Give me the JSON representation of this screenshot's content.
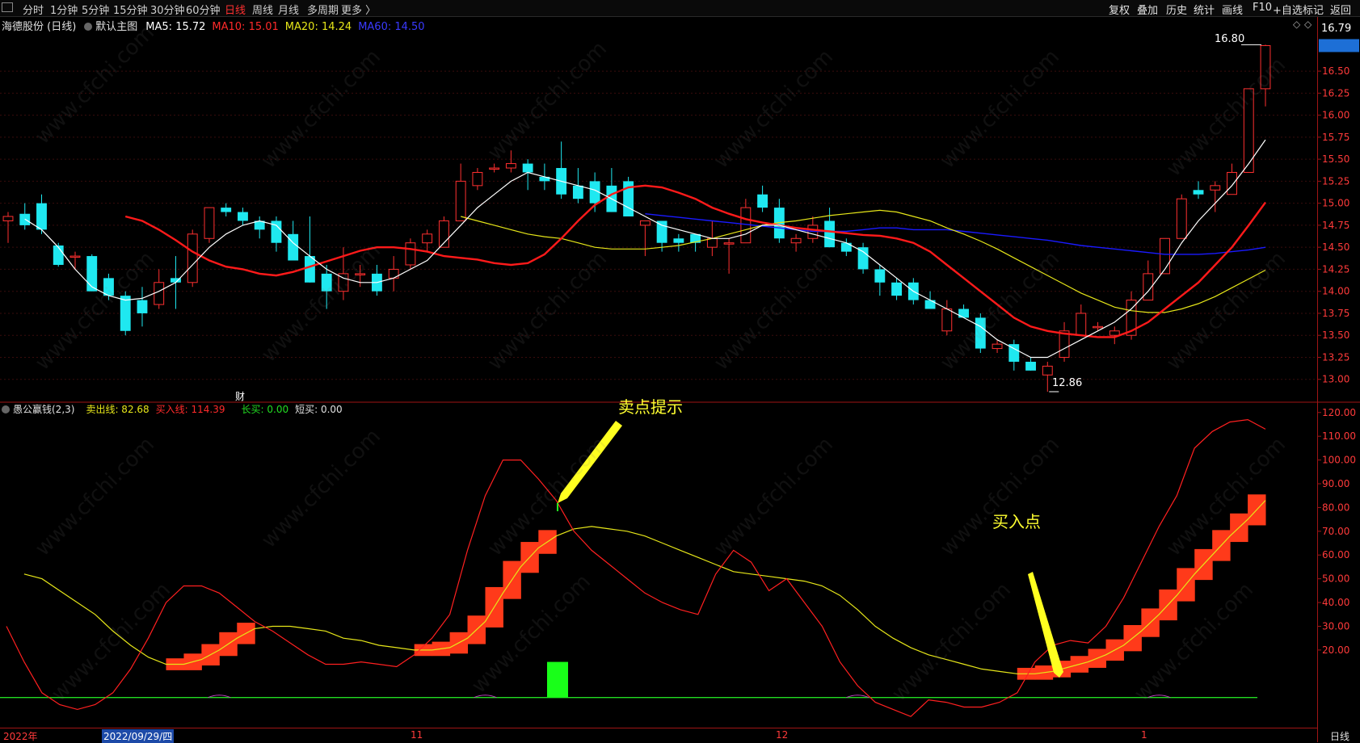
{
  "toolbar": {
    "left": [
      "分时",
      "1分钟",
      "5分钟",
      "15分钟",
      "30分钟",
      "60分钟",
      "日线",
      "周线",
      "月线",
      "多周期",
      "更多 〉"
    ],
    "active": "日线",
    "right": [
      "复权",
      "叠加",
      "历史",
      "统计",
      "画线",
      "F10",
      "+自选",
      "标记",
      "返回"
    ]
  },
  "main_header": {
    "stock": "海德股份 (日线)",
    "chart_name": "默认主图",
    "ma5": "MA5: 15.72",
    "ma10": "MA10: 15.01",
    "ma20": "MA20: 14.24",
    "ma60": "MA60: 14.50"
  },
  "sub_header": {
    "indicator": "愚公赢钱(2,3)",
    "sell": "卖出线: 82.68",
    "buy": "买入线: 114.39",
    "long": "长买: 0.00",
    "short": "短买: 0.00"
  },
  "annotations": {
    "sell_tip": "卖点提示",
    "buy_point": "买入点",
    "high": "16.80",
    "low": "12.86",
    "current": "16.79",
    "fin": "财"
  },
  "xaxis": {
    "year": "2022年",
    "date": "2022/09/29/四",
    "nov": "11",
    "dec": "12",
    "jan": "1",
    "period": "日线"
  },
  "watermark": "www.cfchi.com",
  "colors": {
    "up": "#ff3030",
    "down": "#1fe8f0",
    "ma5": "#ffffff",
    "ma10": "#ff1a1a",
    "ma20": "#e6e619",
    "ma60": "#1a1aff"
  },
  "chart_data": [
    {
      "type": "candlestick",
      "title": "海德股份 (日线)",
      "yticks": [
        13.0,
        13.25,
        13.5,
        13.75,
        14.0,
        14.25,
        14.5,
        14.75,
        15.0,
        15.25,
        15.5,
        15.75,
        16.0,
        16.25,
        16.5
      ],
      "ylim": [
        12.75,
        16.95
      ],
      "ohlc": [
        [
          14.8,
          14.9,
          14.55,
          14.85
        ],
        [
          14.88,
          15.0,
          14.7,
          14.75
        ],
        [
          15.0,
          15.1,
          14.65,
          14.7
        ],
        [
          14.52,
          14.55,
          14.28,
          14.3
        ],
        [
          14.4,
          14.45,
          14.25,
          14.4
        ],
        [
          14.4,
          14.42,
          14.0,
          14.0
        ],
        [
          14.15,
          14.2,
          13.9,
          13.95
        ],
        [
          13.95,
          14.0,
          13.5,
          13.55
        ],
        [
          13.9,
          14.05,
          13.6,
          13.75
        ],
        [
          13.85,
          14.25,
          13.8,
          14.1
        ],
        [
          14.15,
          14.4,
          13.8,
          14.1
        ],
        [
          14.1,
          14.7,
          14.05,
          14.65
        ],
        [
          14.6,
          14.95,
          14.55,
          14.95
        ],
        [
          14.95,
          15.0,
          14.85,
          14.9
        ],
        [
          14.9,
          14.95,
          14.75,
          14.8
        ],
        [
          14.8,
          14.85,
          14.6,
          14.7
        ],
        [
          14.8,
          14.85,
          14.45,
          14.55
        ],
        [
          14.65,
          14.8,
          14.45,
          14.35
        ],
        [
          14.4,
          14.85,
          14.1,
          14.1
        ],
        [
          14.2,
          14.3,
          13.8,
          14.0
        ],
        [
          14.0,
          14.5,
          13.9,
          14.2
        ],
        [
          14.2,
          14.3,
          14.05,
          14.2
        ],
        [
          14.2,
          14.3,
          13.95,
          14.0
        ],
        [
          14.15,
          14.4,
          14.0,
          14.25
        ],
        [
          14.3,
          14.6,
          14.25,
          14.55
        ],
        [
          14.55,
          14.7,
          14.45,
          14.65
        ],
        [
          14.5,
          14.85,
          14.5,
          14.8
        ],
        [
          14.8,
          15.45,
          14.8,
          15.25
        ],
        [
          15.2,
          15.4,
          15.15,
          15.35
        ],
        [
          15.4,
          15.45,
          15.35,
          15.4
        ],
        [
          15.4,
          15.6,
          15.35,
          15.45
        ],
        [
          15.45,
          15.5,
          15.15,
          15.35
        ],
        [
          15.3,
          15.45,
          15.15,
          15.25
        ],
        [
          15.4,
          15.7,
          15.05,
          15.1
        ],
        [
          15.2,
          15.4,
          15.0,
          15.05
        ],
        [
          15.25,
          15.35,
          14.9,
          15.0
        ],
        [
          15.2,
          15.4,
          14.9,
          14.9
        ],
        [
          15.25,
          15.3,
          14.85,
          14.85
        ],
        [
          14.75,
          14.8,
          14.4,
          14.8
        ],
        [
          14.8,
          14.8,
          14.45,
          14.55
        ],
        [
          14.6,
          14.65,
          14.45,
          14.55
        ],
        [
          14.65,
          14.65,
          14.45,
          14.55
        ],
        [
          14.5,
          14.8,
          14.4,
          14.6
        ],
        [
          14.55,
          14.6,
          14.2,
          14.55
        ],
        [
          14.55,
          15.05,
          14.55,
          14.95
        ],
        [
          15.1,
          15.2,
          14.9,
          14.95
        ],
        [
          14.95,
          15.05,
          14.55,
          14.6
        ],
        [
          14.55,
          14.65,
          14.45,
          14.6
        ],
        [
          14.6,
          14.85,
          14.55,
          14.75
        ],
        [
          14.8,
          14.95,
          14.5,
          14.5
        ],
        [
          14.55,
          14.6,
          14.4,
          14.45
        ],
        [
          14.5,
          14.55,
          14.2,
          14.25
        ],
        [
          14.25,
          14.3,
          13.95,
          14.1
        ],
        [
          14.1,
          14.15,
          13.9,
          13.95
        ],
        [
          14.1,
          14.15,
          13.85,
          13.9
        ],
        [
          13.9,
          14.0,
          13.8,
          13.8
        ],
        [
          13.55,
          13.9,
          13.5,
          13.8
        ],
        [
          13.8,
          13.85,
          13.7,
          13.7
        ],
        [
          13.7,
          13.75,
          13.3,
          13.35
        ],
        [
          13.35,
          13.45,
          13.3,
          13.4
        ],
        [
          13.4,
          13.45,
          13.1,
          13.2
        ],
        [
          13.2,
          13.25,
          13.1,
          13.1
        ],
        [
          13.05,
          13.2,
          12.86,
          13.15
        ],
        [
          13.25,
          13.65,
          13.2,
          13.55
        ],
        [
          13.5,
          13.85,
          13.5,
          13.75
        ],
        [
          13.6,
          13.65,
          13.55,
          13.6
        ],
        [
          13.5,
          13.6,
          13.4,
          13.55
        ],
        [
          13.5,
          14.0,
          13.45,
          13.9
        ],
        [
          13.9,
          14.35,
          13.9,
          14.2
        ],
        [
          14.2,
          14.6,
          14.2,
          14.6
        ],
        [
          14.6,
          15.1,
          14.6,
          15.05
        ],
        [
          15.15,
          15.25,
          15.05,
          15.1
        ],
        [
          15.15,
          15.25,
          14.9,
          15.2
        ],
        [
          15.1,
          15.45,
          15.1,
          15.35
        ],
        [
          15.35,
          16.3,
          15.35,
          16.3
        ],
        [
          16.3,
          16.8,
          16.1,
          16.79
        ]
      ],
      "ma5": [
        14.82,
        14.7,
        14.5,
        14.25,
        14.05,
        13.95,
        13.9,
        13.92,
        14.0,
        14.1,
        14.3,
        14.5,
        14.65,
        14.75,
        14.8,
        14.75,
        14.55,
        14.4,
        14.25,
        14.15,
        14.1,
        14.1,
        14.15,
        14.25,
        14.35,
        14.55,
        14.75,
        14.95,
        15.1,
        15.25,
        15.35,
        15.3,
        15.25,
        15.2,
        15.15,
        15.05,
        14.95,
        14.85,
        14.75,
        14.7,
        14.65,
        14.6,
        14.6,
        14.65,
        14.75,
        14.75,
        14.7,
        14.65,
        14.6,
        14.55,
        14.45,
        14.3,
        14.15,
        14.0,
        13.9,
        13.8,
        13.7,
        13.6,
        13.45,
        13.35,
        13.25,
        13.25,
        13.35,
        13.45,
        13.55,
        13.65,
        13.8,
        14.0,
        14.25,
        14.55,
        14.8,
        15.0,
        15.2,
        15.45,
        15.72
      ],
      "ma10": [
        14.85,
        14.8,
        14.7,
        14.58,
        14.45,
        14.35,
        14.28,
        14.25,
        14.2,
        14.18,
        14.22,
        14.28,
        14.34,
        14.4,
        14.46,
        14.5,
        14.5,
        14.48,
        14.45,
        14.4,
        14.38,
        14.36,
        14.32,
        14.3,
        14.32,
        14.42,
        14.6,
        14.8,
        14.98,
        15.1,
        15.18,
        15.2,
        15.18,
        15.12,
        15.05,
        14.95,
        14.88,
        14.82,
        14.78,
        14.75,
        14.72,
        14.7,
        14.68,
        14.66,
        14.64,
        14.63,
        14.6,
        14.55,
        14.45,
        14.3,
        14.15,
        14.0,
        13.85,
        13.7,
        13.6,
        13.55,
        13.52,
        13.5,
        13.48,
        13.48,
        13.55,
        13.65,
        13.8,
        13.95,
        14.1,
        14.3,
        14.5,
        14.75,
        15.01
      ],
      "ma20": [
        14.85,
        14.8,
        14.75,
        14.7,
        14.65,
        14.62,
        14.6,
        14.55,
        14.5,
        14.48,
        14.48,
        14.48,
        14.5,
        14.52,
        14.56,
        14.6,
        14.65,
        14.7,
        14.75,
        14.78,
        14.8,
        14.83,
        14.86,
        14.88,
        14.9,
        14.92,
        14.9,
        14.85,
        14.8,
        14.72,
        14.65,
        14.57,
        14.48,
        14.38,
        14.28,
        14.18,
        14.08,
        13.98,
        13.9,
        13.82,
        13.78,
        13.76,
        13.76,
        13.8,
        13.86,
        13.94,
        14.04,
        14.14,
        14.24
      ],
      "ma60": [
        14.88,
        14.86,
        14.84,
        14.82,
        14.8,
        14.78,
        14.76,
        14.74,
        14.72,
        14.7,
        14.68,
        14.68,
        14.68,
        14.7,
        14.72,
        14.72,
        14.7,
        14.7,
        14.7,
        14.68,
        14.66,
        14.64,
        14.62,
        14.6,
        14.58,
        14.55,
        14.52,
        14.5,
        14.48,
        14.46,
        14.44,
        14.42,
        14.42,
        14.42,
        14.43,
        14.45,
        14.47,
        14.5
      ]
    },
    {
      "type": "line",
      "title": "愚公赢钱(2,3)",
      "yticks": [
        20,
        30,
        40,
        50,
        60,
        70,
        80,
        90,
        100,
        110,
        120
      ],
      "ylim": [
        -12,
        124
      ],
      "series": [
        {
          "name": "买入线",
          "values": [
            30,
            15,
            2,
            -3,
            -5,
            -3,
            2,
            12,
            25,
            40,
            47,
            47,
            44,
            38,
            32,
            28,
            23,
            18,
            14,
            14,
            15,
            14,
            13,
            18,
            25,
            35,
            62,
            85,
            100,
            100,
            92,
            83,
            70,
            62,
            56,
            50,
            44,
            40,
            37,
            35,
            52,
            62,
            57,
            45,
            50,
            40,
            30,
            15,
            5,
            -2,
            -5,
            -8,
            -1,
            -2,
            -4,
            -4,
            -2,
            2,
            15,
            22,
            24,
            23,
            30,
            42,
            57,
            72,
            85,
            105,
            112,
            116,
            117,
            113
          ]
        },
        {
          "name": "卖出线",
          "values": [
            52,
            50,
            45,
            40,
            35,
            28,
            22,
            17,
            14,
            14,
            16,
            20,
            25,
            29,
            30,
            30,
            29,
            28,
            25,
            24,
            22,
            21,
            20,
            20,
            21,
            25,
            32,
            44,
            55,
            63,
            68,
            71,
            72,
            71,
            70,
            68,
            65,
            62,
            59,
            56,
            53,
            52,
            51,
            50,
            49,
            47,
            43,
            37,
            30,
            25,
            21,
            18,
            16,
            14,
            12,
            11,
            10,
            10,
            11,
            13,
            15,
            18,
            22,
            28,
            35,
            43,
            52,
            60,
            68,
            75,
            83
          ]
        },
        {
          "name": "长买",
          "values": [
            0
          ]
        },
        {
          "name": "短买",
          "values": [
            0
          ]
        }
      ]
    }
  ]
}
